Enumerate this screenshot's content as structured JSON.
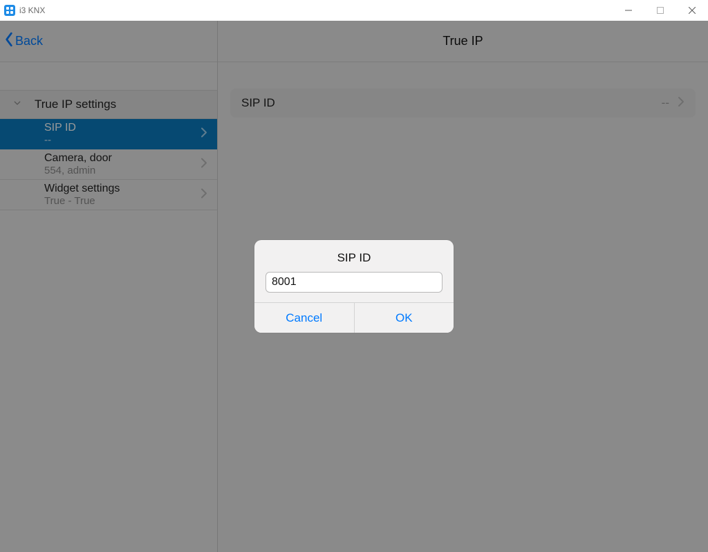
{
  "window": {
    "title": "i3 KNX"
  },
  "sidebar": {
    "back_label": "Back",
    "section_title": "True IP settings",
    "items": [
      {
        "label": "SIP ID",
        "sub": "--",
        "selected": true
      },
      {
        "label": "Camera, door",
        "sub": "554, admin",
        "selected": false
      },
      {
        "label": "Widget settings",
        "sub": "True - True",
        "selected": false
      }
    ]
  },
  "main": {
    "title": "True IP",
    "row": {
      "label": "SIP ID",
      "value": "--"
    }
  },
  "dialog": {
    "title": "SIP ID",
    "input_value": "8001",
    "cancel_label": "Cancel",
    "ok_label": "OK"
  }
}
